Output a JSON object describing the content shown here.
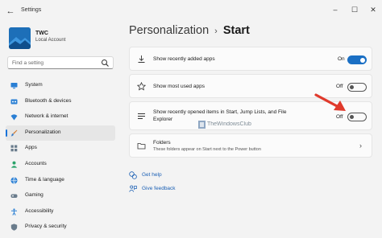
{
  "app": {
    "title": "Settings"
  },
  "user": {
    "name": "TWC",
    "account": "Local Account"
  },
  "search": {
    "placeholder": "Find a setting"
  },
  "nav": {
    "items": [
      {
        "label": "System",
        "icon": "monitor-icon",
        "color": "#2a7fd4"
      },
      {
        "label": "Bluetooth & devices",
        "icon": "bluetooth-icon",
        "color": "#2a7fd4"
      },
      {
        "label": "Network & internet",
        "icon": "wifi-icon",
        "color": "#2a7fd4"
      },
      {
        "label": "Personalization",
        "icon": "brush-icon",
        "color": "#d27a2c",
        "active": true
      },
      {
        "label": "Apps",
        "icon": "apps-icon",
        "color": "#6a7c8c"
      },
      {
        "label": "Accounts",
        "icon": "person-icon",
        "color": "#2aa36a"
      },
      {
        "label": "Time & language",
        "icon": "globe-icon",
        "color": "#2a7fd4"
      },
      {
        "label": "Gaming",
        "icon": "gamepad-icon",
        "color": "#6a7c8c"
      },
      {
        "label": "Accessibility",
        "icon": "accessibility-icon",
        "color": "#2a7fd4"
      },
      {
        "label": "Privacy & security",
        "icon": "shield-icon",
        "color": "#6a7c8c"
      }
    ]
  },
  "breadcrumb": {
    "parent": "Personalization",
    "separator": "›",
    "current": "Start"
  },
  "settings": [
    {
      "label": "Show recently added apps",
      "state": "On",
      "toggle": true
    },
    {
      "label": "Show most used apps",
      "state": "Off",
      "toggle": false
    },
    {
      "label_line1": "Show recently opened items in Start, Jump Lists, and File",
      "label_line2": "Explorer",
      "state": "Off",
      "toggle": false
    },
    {
      "label": "Folders",
      "description": "These folders appear on Start next to the Power button"
    }
  ],
  "watermark": {
    "text": "TheWindowsClub"
  },
  "links": {
    "help": "Get help",
    "feedback": "Give feedback"
  },
  "colors": {
    "accent": "#1a6fc4",
    "arrow": "#e03a2c",
    "link": "#1a5fb4"
  }
}
